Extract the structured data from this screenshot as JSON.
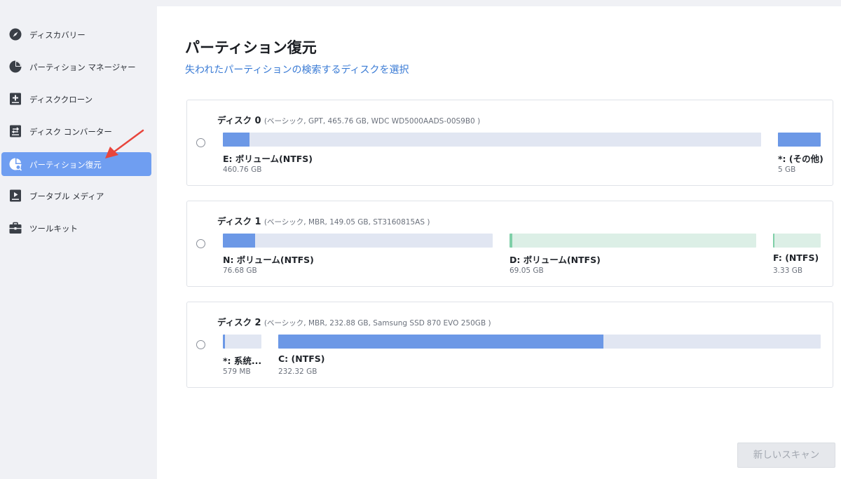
{
  "sidebar": {
    "items": [
      {
        "label": "ディスカバリー",
        "icon": "compass-icon",
        "active": false
      },
      {
        "label": "パーティション マネージャー",
        "icon": "pie-chart-icon",
        "active": false
      },
      {
        "label": "ディスククローン",
        "icon": "add-box-icon",
        "active": false
      },
      {
        "label": "ディスク コンバーター",
        "icon": "convert-icon",
        "active": false
      },
      {
        "label": "パーティション復元",
        "icon": "partition-recovery-icon",
        "active": true
      },
      {
        "label": "ブータブル メディア",
        "icon": "bootable-media-icon",
        "active": false
      },
      {
        "label": "ツールキット",
        "icon": "toolbox-icon",
        "active": false
      }
    ]
  },
  "main": {
    "title": "パーティション復元",
    "subtitle": "失われたパーティションの検索するディスクを選択"
  },
  "disks": [
    {
      "name": "ディスク",
      "number": "0",
      "meta": "(ベーシック, GPT, 465.76 GB, WDC WD5000AADS-00S9B0 )",
      "partitions": [
        {
          "name": "E: ボリューム(NTFS)",
          "size": "460.76 GB",
          "used_fraction": 0.05,
          "color": "blue"
        },
        {
          "name": "*: (その他)",
          "size": "5 GB",
          "used_fraction": 1.0,
          "color": "blue"
        }
      ]
    },
    {
      "name": "ディスク",
      "number": "1",
      "meta": "(ベーシック, MBR, 149.05 GB, ST3160815AS )",
      "partitions": [
        {
          "name": "N: ボリューム(NTFS)",
          "size": "76.68 GB",
          "used_fraction": 0.12,
          "color": "blue"
        },
        {
          "name": "D: ボリューム(NTFS)",
          "size": "69.05 GB",
          "used_fraction": 0.01,
          "color": "green"
        },
        {
          "name": "F: (NTFS)",
          "size": "3.33 GB",
          "used_fraction": 0.03,
          "color": "green"
        }
      ]
    },
    {
      "name": "ディスク",
      "number": "2",
      "meta": "(ベーシック, MBR, 232.88 GB, Samsung SSD 870 EVO 250GB )",
      "partitions": [
        {
          "name": "*: 系统...",
          "size": "579 MB",
          "used_fraction": 0.05,
          "color": "blue"
        },
        {
          "name": "C: (NTFS)",
          "size": "232.32 GB",
          "used_fraction": 0.6,
          "color": "blue"
        }
      ]
    }
  ],
  "actions": {
    "scan_label": "新しいスキャン"
  },
  "colors": {
    "accent": "#6f9ef1",
    "link": "#3a7bd5",
    "used_blue": "#6c98e6",
    "used_green": "#7fcfa8",
    "free_blue": "#e1e6f2",
    "free_green": "#dcefe6",
    "annotation_arrow": "#e8453c"
  }
}
